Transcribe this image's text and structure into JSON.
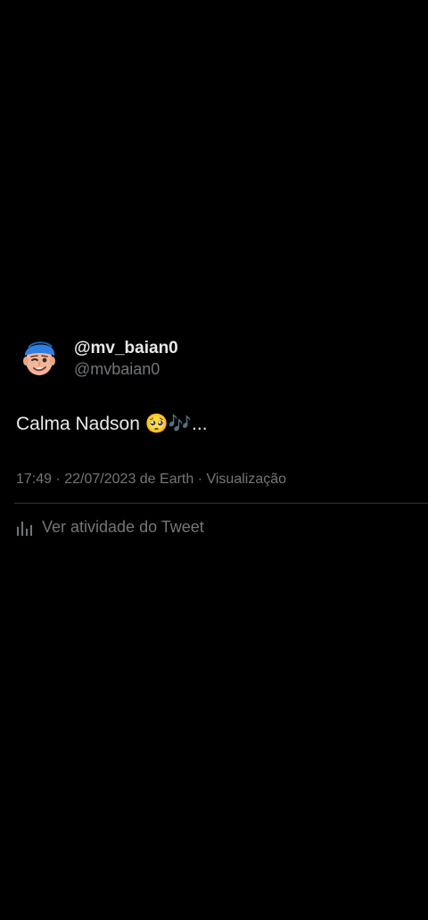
{
  "tweet": {
    "display_name": "@mv_baian0",
    "handle": "@mvbaian0",
    "text": "Calma Nadson 🥺🎶...",
    "meta": "17:49 · 22/07/2023 de Earth · Visualização",
    "activity_label": "Ver atividade do Tweet",
    "activity_icon": "analytics-bar-chart-icon",
    "avatar_icon": "memoji-avatar-blue-cap"
  },
  "colors": {
    "background": "#000000",
    "primary_text": "#e7e9ea",
    "secondary_text": "#71767b",
    "divider": "#2f3336",
    "cap_blue": "#2f7fe0"
  }
}
